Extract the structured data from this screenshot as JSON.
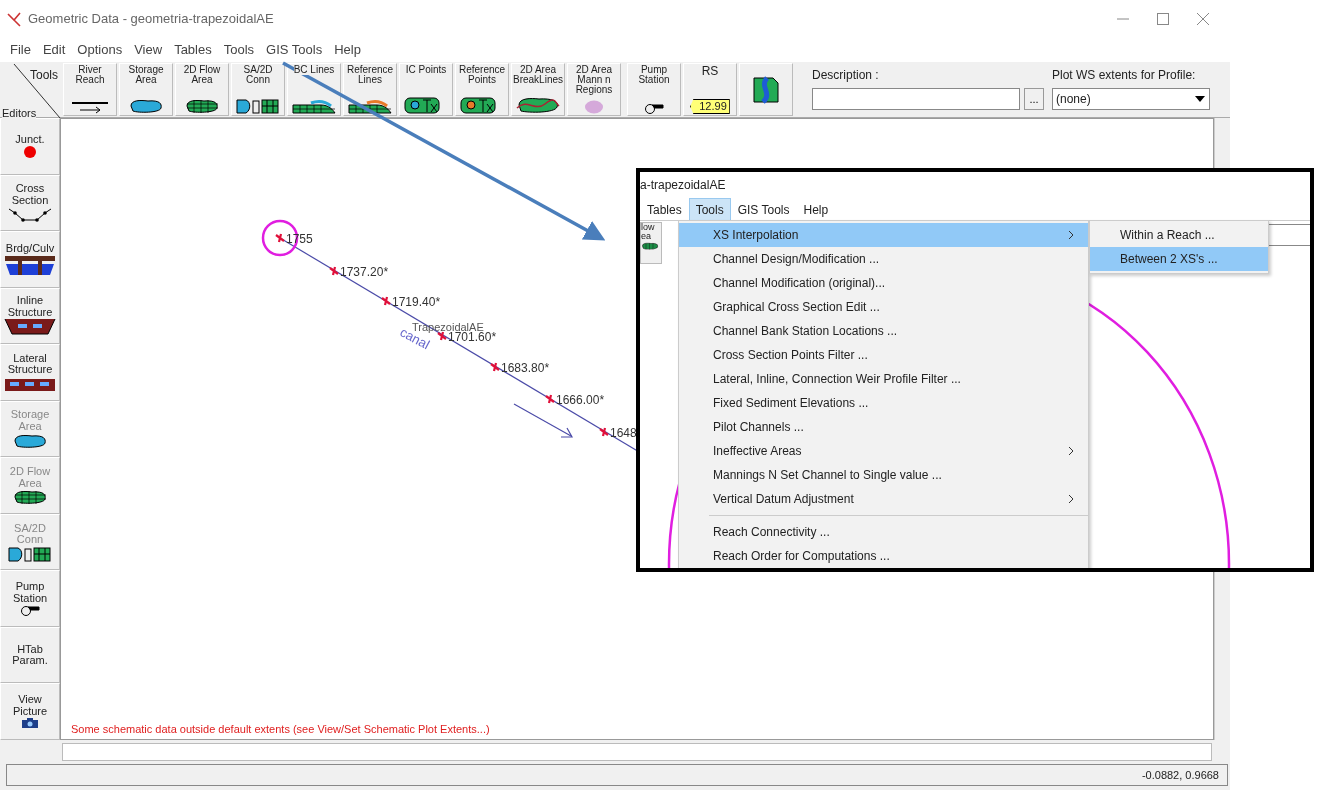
{
  "window": {
    "title": "Geometric Data - geometria-trapezoidalAE"
  },
  "menu": [
    "File",
    "Edit",
    "Options",
    "View",
    "Tables",
    "Tools",
    "GIS Tools",
    "Help"
  ],
  "toolbar": {
    "corner_top": "Tools",
    "corner_bottom": "Editors",
    "buttons": [
      {
        "label": "River Reach",
        "kind": "river"
      },
      {
        "label": "Storage Area",
        "kind": "storage"
      },
      {
        "label": "2D Flow Area",
        "kind": "flow2d"
      },
      {
        "label": "SA/2D Conn",
        "kind": "conn"
      },
      {
        "label": "BC Lines",
        "kind": "bclines"
      },
      {
        "label": "Reference Lines",
        "kind": "reflines"
      },
      {
        "label": "IC Points",
        "kind": "icpoints"
      },
      {
        "label": "Reference Points",
        "kind": "refpoints"
      },
      {
        "label": "2D Area BreakLines",
        "kind": "breaklines"
      },
      {
        "label": "2D Area Mann n Regions",
        "kind": "mann"
      },
      {
        "label": "Pump Station",
        "kind": "pump"
      },
      {
        "label": "RS",
        "kind": "rs",
        "tag": "12.99"
      },
      {
        "kind": "map"
      }
    ],
    "description": {
      "label": "Description :",
      "ellipsis": "..."
    },
    "plot_ws": {
      "label": "Plot WS extents for Profile:",
      "value": "(none)"
    }
  },
  "editors": [
    {
      "label": "Junct.",
      "kind": "junction",
      "disabled": false
    },
    {
      "label": "Cross Section",
      "kind": "xs",
      "disabled": false
    },
    {
      "label": "Brdg/Culv",
      "kind": "bridge",
      "disabled": false
    },
    {
      "label": "Inline Structure",
      "kind": "inline",
      "disabled": false
    },
    {
      "label": "Lateral Structure",
      "kind": "lateral",
      "disabled": false
    },
    {
      "label": "Storage Area",
      "kind": "storage",
      "disabled": true
    },
    {
      "label": "2D Flow Area",
      "kind": "flow2d",
      "disabled": true
    },
    {
      "label": "SA/2D Conn",
      "kind": "conn",
      "disabled": true
    },
    {
      "label": "Pump Station",
      "kind": "pump",
      "disabled": false
    },
    {
      "label": "HTab Param.",
      "kind": "none",
      "disabled": false
    },
    {
      "label": "View Picture",
      "kind": "camera",
      "disabled": false
    }
  ],
  "schematic": {
    "reach_label": "TrapezoidalAE",
    "river_label": "canal",
    "stations": [
      "1755",
      "1737.20*",
      "1719.40*",
      "1701.60*",
      "1683.80*",
      "1666.00*",
      "1648"
    ],
    "warning": "Some schematic data outside default extents (see View/Set Schematic Plot Extents...)"
  },
  "status_bar": {
    "coordinates": "-0.0882, 0.9668"
  },
  "inset": {
    "title": "a-trapezoidalAE",
    "toolbar_fragment": [
      "low",
      "ea"
    ],
    "menu": [
      {
        "label": "Tables",
        "selected": false
      },
      {
        "label": "Tools",
        "selected": true
      },
      {
        "label": "GIS Tools",
        "selected": false
      },
      {
        "label": "Help",
        "selected": false
      }
    ],
    "menu_items": [
      {
        "kind": "item",
        "label": "XS Interpolation",
        "submenu": true,
        "selected": true
      },
      {
        "kind": "item",
        "label": "Channel Design/Modification ...",
        "submenu": false,
        "selected": false
      },
      {
        "kind": "item",
        "label": "Channel Modification (original)...",
        "submenu": false,
        "selected": false
      },
      {
        "kind": "item",
        "label": "Graphical Cross Section Edit ...",
        "submenu": false,
        "selected": false
      },
      {
        "kind": "item",
        "label": "Channel Bank Station Locations ...",
        "submenu": false,
        "selected": false
      },
      {
        "kind": "item",
        "label": "Cross Section Points Filter ...",
        "submenu": false,
        "selected": false
      },
      {
        "kind": "item",
        "label": "Lateral, Inline, Connection Weir Profile Filter ...",
        "submenu": false,
        "selected": false
      },
      {
        "kind": "item",
        "label": "Fixed Sediment Elevations ...",
        "submenu": false,
        "selected": false
      },
      {
        "kind": "item",
        "label": "Pilot Channels ...",
        "submenu": false,
        "selected": false
      },
      {
        "kind": "item",
        "label": "Ineffective Areas",
        "submenu": true,
        "selected": false
      },
      {
        "kind": "item",
        "label": "Mannings N Set Channel to Single value ...",
        "submenu": false,
        "selected": false
      },
      {
        "kind": "item",
        "label": "Vertical Datum Adjustment",
        "submenu": true,
        "selected": false
      },
      {
        "kind": "separator"
      },
      {
        "kind": "item",
        "label": "Reach Connectivity ...",
        "submenu": false,
        "selected": false
      },
      {
        "kind": "item",
        "label": "Reach Order for Computations ...",
        "submenu": false,
        "selected": false
      }
    ],
    "submenu_items": [
      {
        "label": "Within a Reach ...",
        "selected": false
      },
      {
        "label": "Between 2 XS's ...",
        "selected": true
      }
    ]
  }
}
